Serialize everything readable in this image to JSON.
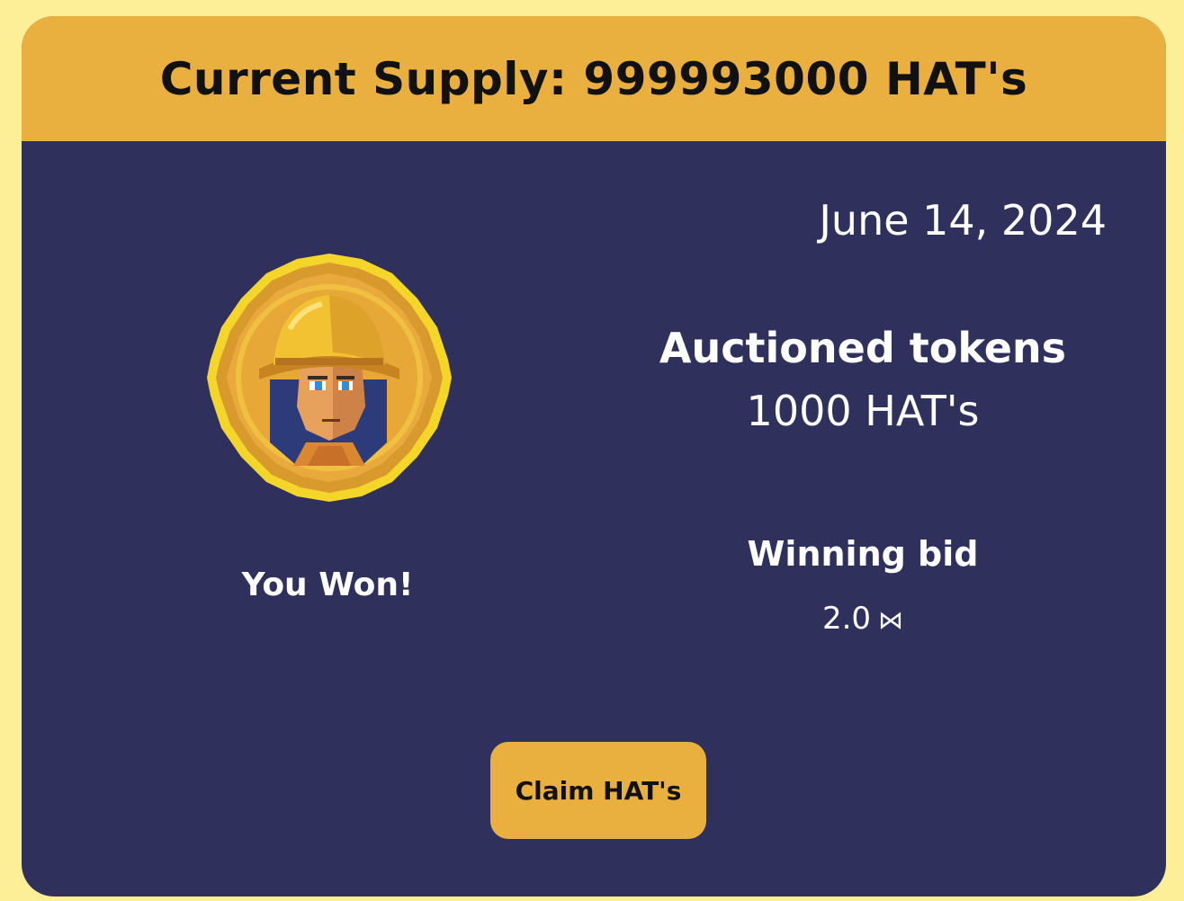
{
  "header": {
    "title": "Current Supply: 999993000 HAT's"
  },
  "auction": {
    "date": "June 14, 2024",
    "status": "You Won!",
    "tokens_label": "Auctioned tokens",
    "tokens_value": "1000 HAT's",
    "bid_label": "Winning bid",
    "bid_value": "2.0",
    "bid_currency_icon": "near-icon"
  },
  "token_image": {
    "icon": "pixel-hat-avatar-coin"
  },
  "actions": {
    "claim_label": "Claim HAT's"
  },
  "colors": {
    "background": "#fdef98",
    "card": "#2f315c",
    "accent": "#e9b03f",
    "text_light": "#ffffff",
    "text_dark": "#111111"
  }
}
